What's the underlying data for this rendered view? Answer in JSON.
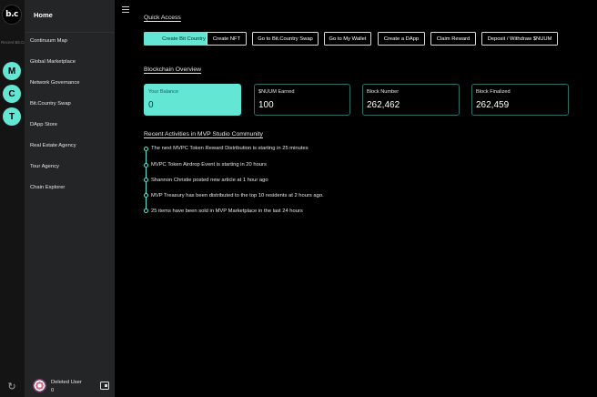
{
  "rail": {
    "logo_text": "b.c",
    "recent_label": "Recent Bit.Countries",
    "circles": [
      "M",
      "C",
      "T"
    ],
    "bottom_icon": "logout-icon"
  },
  "sidebar": {
    "home": "Home",
    "items": [
      "Continuum Map",
      "Global Marketplace",
      "Network Governance",
      "Bit.Country Swap",
      "DApp Store",
      "Real Estate Agency",
      "Tour Agency",
      "Chain Explorer"
    ],
    "user": {
      "name": "Deleted User",
      "balance": "0"
    }
  },
  "quick_access": {
    "title": "Quick Access",
    "buttons": [
      "Create Bit Country",
      "Create NFT",
      "Go to Bit.Country Swap",
      "Go to My Wallet",
      "Create a DApp",
      "Claim Reward",
      "Deposit / Withdraw $NUUM"
    ]
  },
  "overview": {
    "title": "Blockchain Overview",
    "cards": [
      {
        "label": "Your Balance",
        "value": "0"
      },
      {
        "label": "$NUUM Earned",
        "value": "100"
      },
      {
        "label": "Block Number",
        "value": "262,462"
      },
      {
        "label": "Block Finalized",
        "value": "262,459"
      }
    ]
  },
  "activities": {
    "title": "Recent Activities in MVP Studio Community",
    "items": [
      "The next MVPC Token Reward Distribution is starting in 25 minutes",
      "MVPC Token Airdrop Event is starting in 20 hours",
      "Shannon Christie posted new article at 1 hour ago",
      "MVP Treasury has been distributed to the top 10 residents at 2 hours ago.",
      "25 items have been sold in MVP Marketplace in the last 24 hours"
    ]
  },
  "colors": {
    "accent": "#63e6d4",
    "sidebar": "#232527",
    "rail": "#141414",
    "background": "#000000"
  }
}
